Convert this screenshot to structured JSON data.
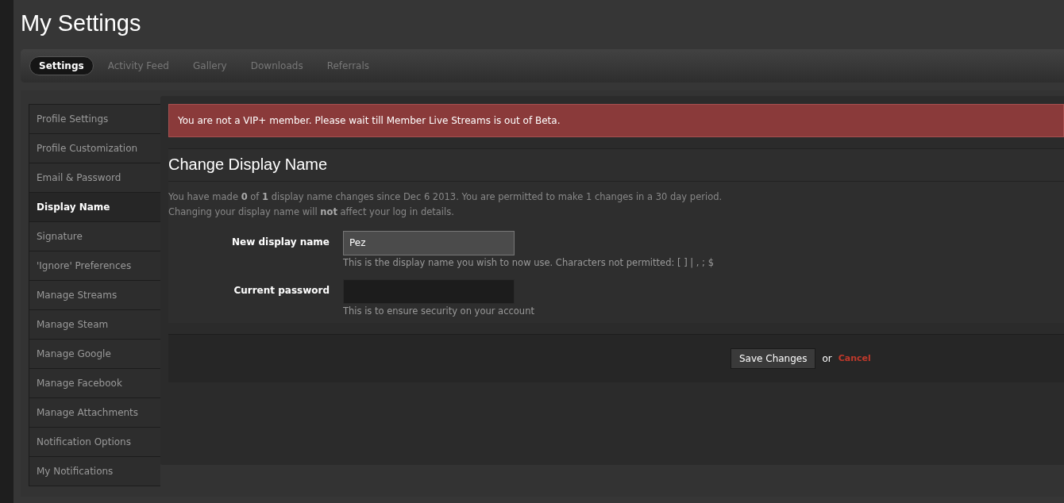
{
  "title": "My Settings",
  "tabs": [
    {
      "label": "Settings",
      "selected": true
    },
    {
      "label": "Activity Feed",
      "selected": false
    },
    {
      "label": "Gallery",
      "selected": false
    },
    {
      "label": "Downloads",
      "selected": false
    },
    {
      "label": "Referrals",
      "selected": false
    }
  ],
  "sidebar": {
    "items": [
      {
        "label": "Profile Settings",
        "selected": false
      },
      {
        "label": "Profile Customization",
        "selected": false
      },
      {
        "label": "Email & Password",
        "selected": false
      },
      {
        "label": "Display Name",
        "selected": true
      },
      {
        "label": "Signature",
        "selected": false
      },
      {
        "label": "'Ignore' Preferences",
        "selected": false
      },
      {
        "label": "Manage Streams",
        "selected": false
      },
      {
        "label": "Manage Steam",
        "selected": false
      },
      {
        "label": "Manage Google",
        "selected": false
      },
      {
        "label": "Manage Facebook",
        "selected": false
      },
      {
        "label": "Manage Attachments",
        "selected": false
      },
      {
        "label": "Notification Options",
        "selected": false
      },
      {
        "label": "My Notifications",
        "selected": false
      }
    ]
  },
  "alert": "You are not a VIP+ member. Please wait till Member Live Streams is out of Beta.",
  "heading": "Change Display Name",
  "intro": [
    "You have made **0** of **1** display name changes since Dec 6 2013. You are permitted to make 1 changes in a 30 day period.",
    "Changing your display name will **not** affect your log in details."
  ],
  "fields": [
    {
      "label": "New display name",
      "value": "Pez",
      "hint": "This is the display name you wish to now use. Characters not permitted: [ ] | , ; $",
      "kind": "text"
    },
    {
      "label": "Current password",
      "hint": "This is to ensure security on your account",
      "kind": "password"
    }
  ],
  "save_button": "Save Changes",
  "or_text": "or",
  "cancel_link": "Cancel"
}
